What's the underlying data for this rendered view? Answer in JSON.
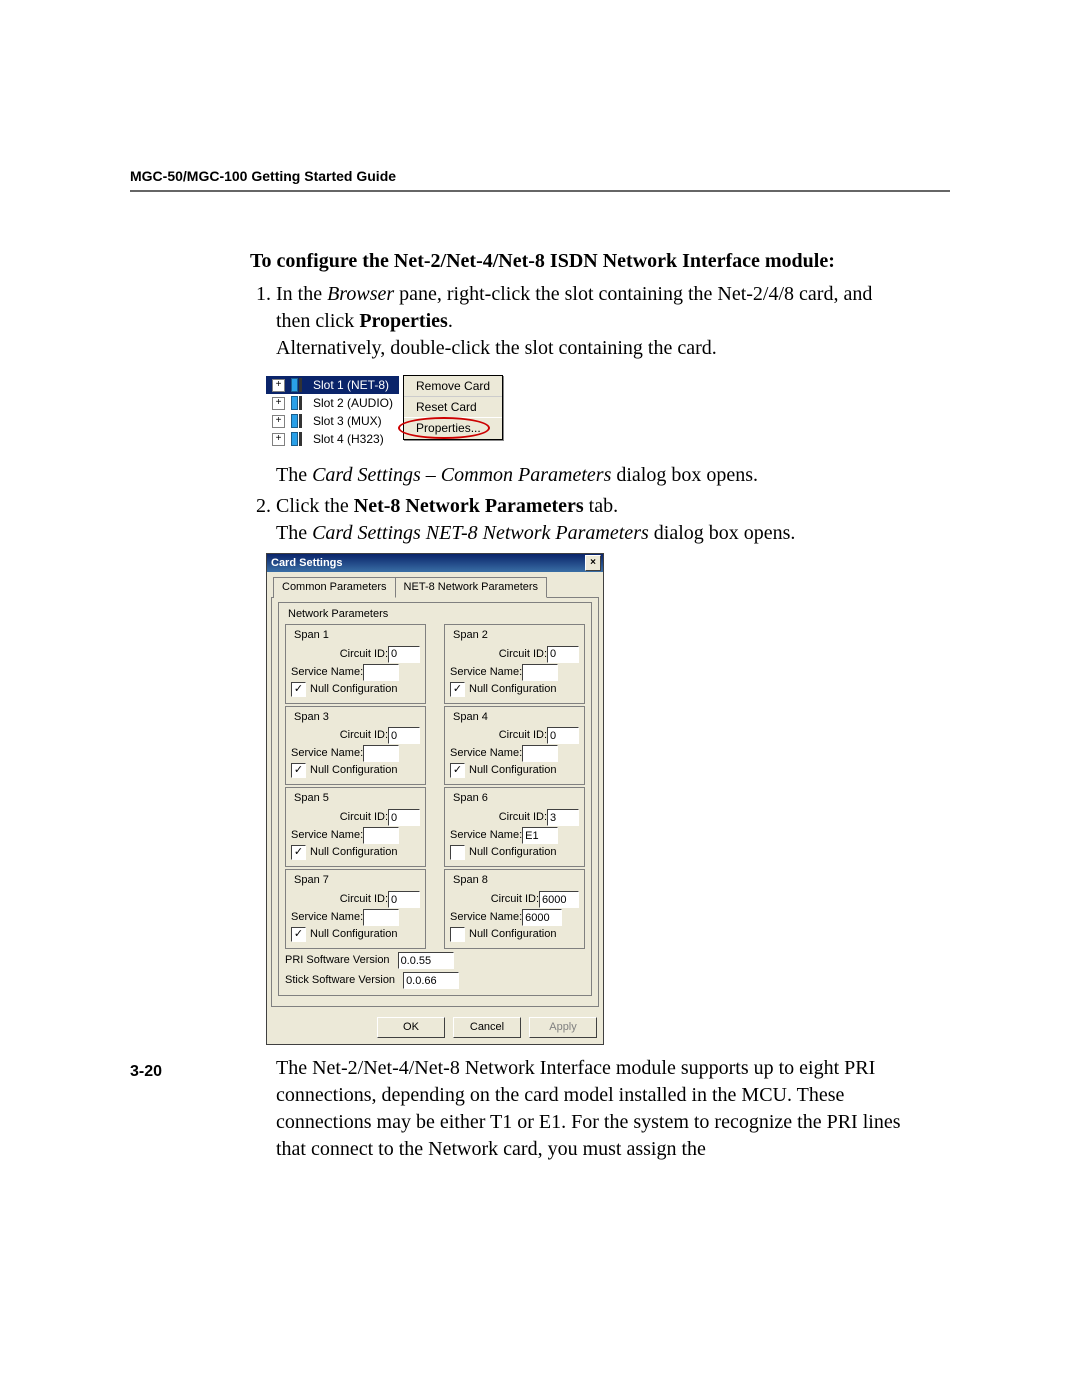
{
  "header": "MGC-50/MGC-100 Getting Started Guide",
  "page_number": "3-20",
  "section_title": "To configure the Net-2/Net-4/Net-8 ISDN Network Interface module:",
  "step1_a": "In the ",
  "step1_browser": "Browser",
  "step1_b": " pane, right-click the slot containing the Net-2/4/8 card, and then click ",
  "step1_properties": "Properties",
  "step1_c": ".",
  "step1_alt": "Alternatively, double-click the slot containing the card.",
  "intermission_a": "The ",
  "intermission_i1": "Card Settings – Common Parameters",
  "intermission_b": " dialog box opens.",
  "step2_a": "Click the ",
  "step2_bold": "Net-8 Network Parameters",
  "step2_b": " tab.",
  "step2_post_a": "The ",
  "step2_post_i": "Card Settings NET-8 Network Parameters",
  "step2_post_b": " dialog box opens.",
  "after_dialog": "The Net-2/Net-4/Net-8 Network Interface module supports up to eight PRI connections, depending on the card model installed in the MCU. These connections may be either T1 or E1. For the system to recognize the PRI lines that connect to the Network card, you must assign the",
  "tree": {
    "items": [
      {
        "label": "Slot 1 (NET-8)",
        "selected": true
      },
      {
        "label": "Slot 2 (AUDIO)"
      },
      {
        "label": "Slot 3 (MUX)"
      },
      {
        "label": "Slot 4 (H323)"
      }
    ],
    "ctx_items": [
      "Remove Card",
      "Reset Card",
      "Properties..."
    ]
  },
  "dialog": {
    "title": "Card Settings",
    "tabs": [
      "Common Parameters",
      "NET-8 Network Parameters"
    ],
    "group_label": "Network Parameters",
    "field_circuit": "Circuit ID:",
    "field_service": "Service Name:",
    "field_null": "Null Configuration",
    "spans": [
      {
        "legend": "Span 1",
        "circuit": "0",
        "service": "",
        "null": true
      },
      {
        "legend": "Span 2",
        "circuit": "0",
        "service": "",
        "null": true
      },
      {
        "legend": "Span 3",
        "circuit": "0",
        "service": "",
        "null": true
      },
      {
        "legend": "Span 4",
        "circuit": "0",
        "service": "",
        "null": true
      },
      {
        "legend": "Span 5",
        "circuit": "0",
        "service": "",
        "null": true
      },
      {
        "legend": "Span 6",
        "circuit": "3",
        "service": "E1",
        "null": false
      },
      {
        "legend": "Span 7",
        "circuit": "0",
        "service": "",
        "null": true
      },
      {
        "legend": "Span 8",
        "circuit": "6000",
        "service": "6000",
        "null": false
      }
    ],
    "pri_label": "PRI Software Version",
    "pri_value": "0.0.55",
    "stick_label": "Stick Software Version",
    "stick_value": "0.0.66",
    "buttons": {
      "ok": "OK",
      "cancel": "Cancel",
      "apply": "Apply"
    }
  }
}
